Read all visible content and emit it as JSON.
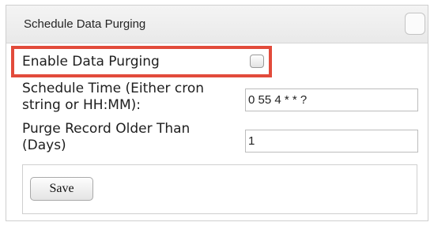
{
  "panel": {
    "title": "Schedule Data Purging"
  },
  "form": {
    "enable_label": "Enable Data Purging",
    "enable_checked": false,
    "schedule_label_line1": "Schedule Time (Either cron",
    "schedule_label_line2": "string or HH:MM):",
    "schedule_value": "0 55 4 * * ?",
    "purge_label_line1": "Purge Record Older Than",
    "purge_label_line2": "(Days)",
    "purge_value": "1",
    "save_label": "Save"
  },
  "colors": {
    "highlight": "#e24b3b",
    "header_bg": "#eeeeee",
    "border": "#cfcfcf"
  }
}
